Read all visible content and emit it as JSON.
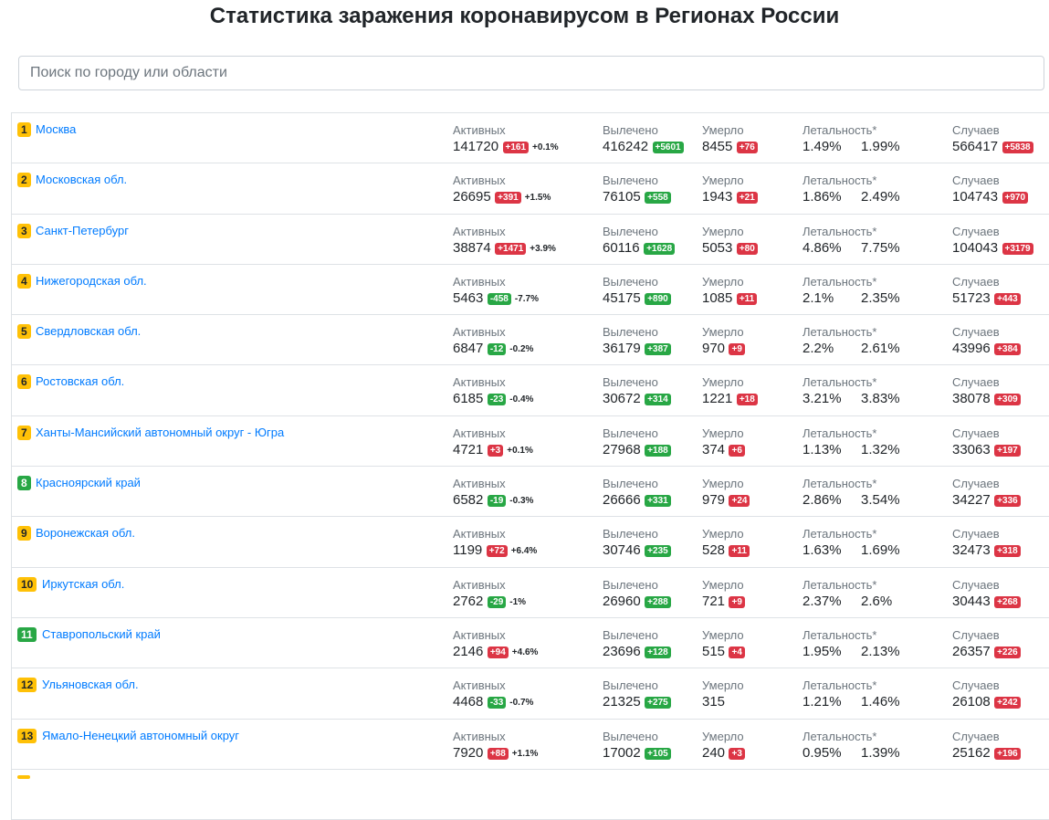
{
  "title": "Статистика заражения коронавирусом в Регионах России",
  "search": {
    "placeholder": "Поиск по городу или области"
  },
  "labels": {
    "active": "Активных",
    "recovered": "Вылечено",
    "deaths": "Умерло",
    "lethality": "Летальность*",
    "cases": "Случаев"
  },
  "colors": {
    "link": "#007bff",
    "badge_red": "#dc3545",
    "badge_green": "#28a745",
    "rank_yellow": "#ffc107"
  },
  "regions": [
    {
      "rank": "1",
      "rank_color": "yellow",
      "name": "Москва",
      "active": "141720",
      "active_delta": "+161",
      "active_delta_color": "red",
      "active_pct": "+0.1%",
      "recovered": "416242",
      "recovered_delta": "+5601",
      "deaths": "8455",
      "deaths_delta": "+76",
      "let1": "1.49%",
      "let2": "1.99%",
      "cases": "566417",
      "cases_delta": "+5838"
    },
    {
      "rank": "2",
      "rank_color": "yellow",
      "name": "Московская обл.",
      "active": "26695",
      "active_delta": "+391",
      "active_delta_color": "red",
      "active_pct": "+1.5%",
      "recovered": "76105",
      "recovered_delta": "+558",
      "deaths": "1943",
      "deaths_delta": "+21",
      "let1": "1.86%",
      "let2": "2.49%",
      "cases": "104743",
      "cases_delta": "+970"
    },
    {
      "rank": "3",
      "rank_color": "yellow",
      "name": "Санкт-Петербург",
      "active": "38874",
      "active_delta": "+1471",
      "active_delta_color": "red",
      "active_pct": "+3.9%",
      "recovered": "60116",
      "recovered_delta": "+1628",
      "deaths": "5053",
      "deaths_delta": "+80",
      "let1": "4.86%",
      "let2": "7.75%",
      "cases": "104043",
      "cases_delta": "+3179"
    },
    {
      "rank": "4",
      "rank_color": "yellow",
      "name": "Нижегородская обл.",
      "active": "5463",
      "active_delta": "-458",
      "active_delta_color": "green",
      "active_pct": "-7.7%",
      "recovered": "45175",
      "recovered_delta": "+890",
      "deaths": "1085",
      "deaths_delta": "+11",
      "let1": "2.1%",
      "let2": "2.35%",
      "cases": "51723",
      "cases_delta": "+443"
    },
    {
      "rank": "5",
      "rank_color": "yellow",
      "name": "Свердловская обл.",
      "active": "6847",
      "active_delta": "-12",
      "active_delta_color": "green",
      "active_pct": "-0.2%",
      "recovered": "36179",
      "recovered_delta": "+387",
      "deaths": "970",
      "deaths_delta": "+9",
      "let1": "2.2%",
      "let2": "2.61%",
      "cases": "43996",
      "cases_delta": "+384"
    },
    {
      "rank": "6",
      "rank_color": "yellow",
      "name": "Ростовская обл.",
      "active": "6185",
      "active_delta": "-23",
      "active_delta_color": "green",
      "active_pct": "-0.4%",
      "recovered": "30672",
      "recovered_delta": "+314",
      "deaths": "1221",
      "deaths_delta": "+18",
      "let1": "3.21%",
      "let2": "3.83%",
      "cases": "38078",
      "cases_delta": "+309"
    },
    {
      "rank": "7",
      "rank_color": "yellow",
      "name": "Ханты-Мансийский автономный округ - Югра",
      "active": "4721",
      "active_delta": "+3",
      "active_delta_color": "red",
      "active_pct": "+0.1%",
      "recovered": "27968",
      "recovered_delta": "+188",
      "deaths": "374",
      "deaths_delta": "+6",
      "let1": "1.13%",
      "let2": "1.32%",
      "cases": "33063",
      "cases_delta": "+197"
    },
    {
      "rank": "8",
      "rank_color": "green",
      "name": "Красноярский край",
      "active": "6582",
      "active_delta": "-19",
      "active_delta_color": "green",
      "active_pct": "-0.3%",
      "recovered": "26666",
      "recovered_delta": "+331",
      "deaths": "979",
      "deaths_delta": "+24",
      "let1": "2.86%",
      "let2": "3.54%",
      "cases": "34227",
      "cases_delta": "+336"
    },
    {
      "rank": "9",
      "rank_color": "yellow",
      "name": "Воронежская обл.",
      "active": "1199",
      "active_delta": "+72",
      "active_delta_color": "red",
      "active_pct": "+6.4%",
      "recovered": "30746",
      "recovered_delta": "+235",
      "deaths": "528",
      "deaths_delta": "+11",
      "let1": "1.63%",
      "let2": "1.69%",
      "cases": "32473",
      "cases_delta": "+318"
    },
    {
      "rank": "10",
      "rank_color": "yellow",
      "name": "Иркутская обл.",
      "active": "2762",
      "active_delta": "-29",
      "active_delta_color": "green",
      "active_pct": "-1%",
      "recovered": "26960",
      "recovered_delta": "+288",
      "deaths": "721",
      "deaths_delta": "+9",
      "let1": "2.37%",
      "let2": "2.6%",
      "cases": "30443",
      "cases_delta": "+268"
    },
    {
      "rank": "11",
      "rank_color": "green",
      "name": "Ставропольский край",
      "active": "2146",
      "active_delta": "+94",
      "active_delta_color": "red",
      "active_pct": "+4.6%",
      "recovered": "23696",
      "recovered_delta": "+128",
      "deaths": "515",
      "deaths_delta": "+4",
      "let1": "1.95%",
      "let2": "2.13%",
      "cases": "26357",
      "cases_delta": "+226"
    },
    {
      "rank": "12",
      "rank_color": "yellow",
      "name": "Ульяновская обл.",
      "active": "4468",
      "active_delta": "-33",
      "active_delta_color": "green",
      "active_pct": "-0.7%",
      "recovered": "21325",
      "recovered_delta": "+275",
      "deaths": "315",
      "deaths_delta": "",
      "let1": "1.21%",
      "let2": "1.46%",
      "cases": "26108",
      "cases_delta": "+242"
    },
    {
      "rank": "13",
      "rank_color": "yellow",
      "name": "Ямало-Ненецкий автономный округ",
      "active": "7920",
      "active_delta": "+88",
      "active_delta_color": "red",
      "active_pct": "+1.1%",
      "recovered": "17002",
      "recovered_delta": "+105",
      "deaths": "240",
      "deaths_delta": "+3",
      "let1": "0.95%",
      "let2": "1.39%",
      "cases": "25162",
      "cases_delta": "+196"
    }
  ]
}
